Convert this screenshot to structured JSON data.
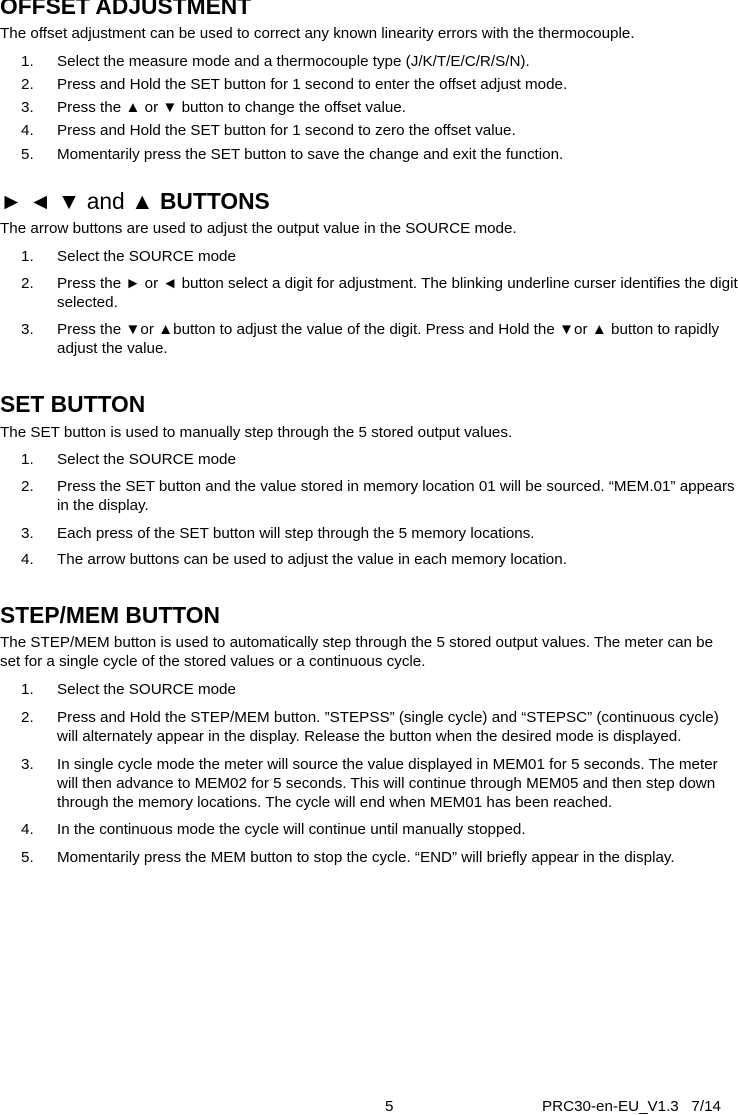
{
  "sections": [
    {
      "heading": "OFFSET ADJUSTMENT",
      "intro": "The offset adjustment can be used to correct any known linearity errors with the thermocouple.",
      "items": [
        {
          "num": "1.",
          "text": "Select the measure mode and a thermocouple type (J/K/T/E/C/R/S/N)."
        },
        {
          "num": "2.",
          "text": "Press and Hold the SET button for 1 second to enter the offset adjust mode."
        },
        {
          "num": "3.",
          "text": "Press the ▲ or ▼ button to change the offset value."
        },
        {
          "num": "4.",
          "text": "Press and Hold the SET button for 1 second to zero the offset value."
        },
        {
          "num": "5.",
          "text": "Momentarily press the SET button to save the change and exit the function."
        }
      ]
    },
    {
      "heading_prefix": "► ◄ ▼ and ▲ ",
      "heading": "BUTTONS",
      "intro": "The arrow buttons are used to adjust the output value in the SOURCE mode.",
      "items": [
        {
          "num": "1.",
          "text": "Select the SOURCE mode"
        },
        {
          "num": "2.",
          "text": "Press the ► or ◄ button select a digit for adjustment. The blinking underline curser identifies the digit selected."
        },
        {
          "num": "3.",
          "text": "Press the ▼or ▲button to adjust the value of the digit. Press and Hold the ▼or ▲ button to rapidly adjust the value."
        }
      ]
    },
    {
      "heading": "SET BUTTON",
      "intro": "The SET button is used to manually step through the 5 stored output values.",
      "items": [
        {
          "num": "1.",
          "text": "Select the SOURCE mode"
        },
        {
          "num": "2.",
          "text": "Press the SET button and the value stored in memory location 01 will be sourced. “MEM.01” appears in the display."
        },
        {
          "num": "3.",
          "text": "Each press of the SET button will step through the 5 memory locations."
        },
        {
          "num": "4.",
          "text": "The arrow buttons can be used to adjust the value in each memory location."
        }
      ]
    },
    {
      "heading": "STEP/MEM BUTTON",
      "intro": "The STEP/MEM button is used to automatically step through the 5 stored output values. The meter can be set for a single cycle of the stored values or a continuous cycle.",
      "items": [
        {
          "num": "1.",
          "text": "Select the SOURCE mode"
        },
        {
          "num": "2.",
          "text": "Press and Hold the STEP/MEM button. ”STEPSS” (single cycle) and “STEPSC” (continuous cycle) will alternately appear in the display. Release the button when the desired mode is displayed."
        },
        {
          "num": "3.",
          "text": "In single cycle mode the meter will source the value displayed in MEM01 for 5 seconds. The meter will then advance to MEM02 for 5 seconds. This will continue through MEM05 and then step down through the memory locations. The cycle will end when MEM01 has been reached."
        },
        {
          "num": "4.",
          "text": "In the continuous mode the cycle will continue until manually stopped."
        },
        {
          "num": "5.",
          "text": "Momentarily press the MEM button to stop the cycle. “END” will briefly appear in the display."
        }
      ]
    }
  ],
  "footer": {
    "page_number": "5",
    "doc_id": "PRC30-en-EU_V1.3   7/14"
  }
}
